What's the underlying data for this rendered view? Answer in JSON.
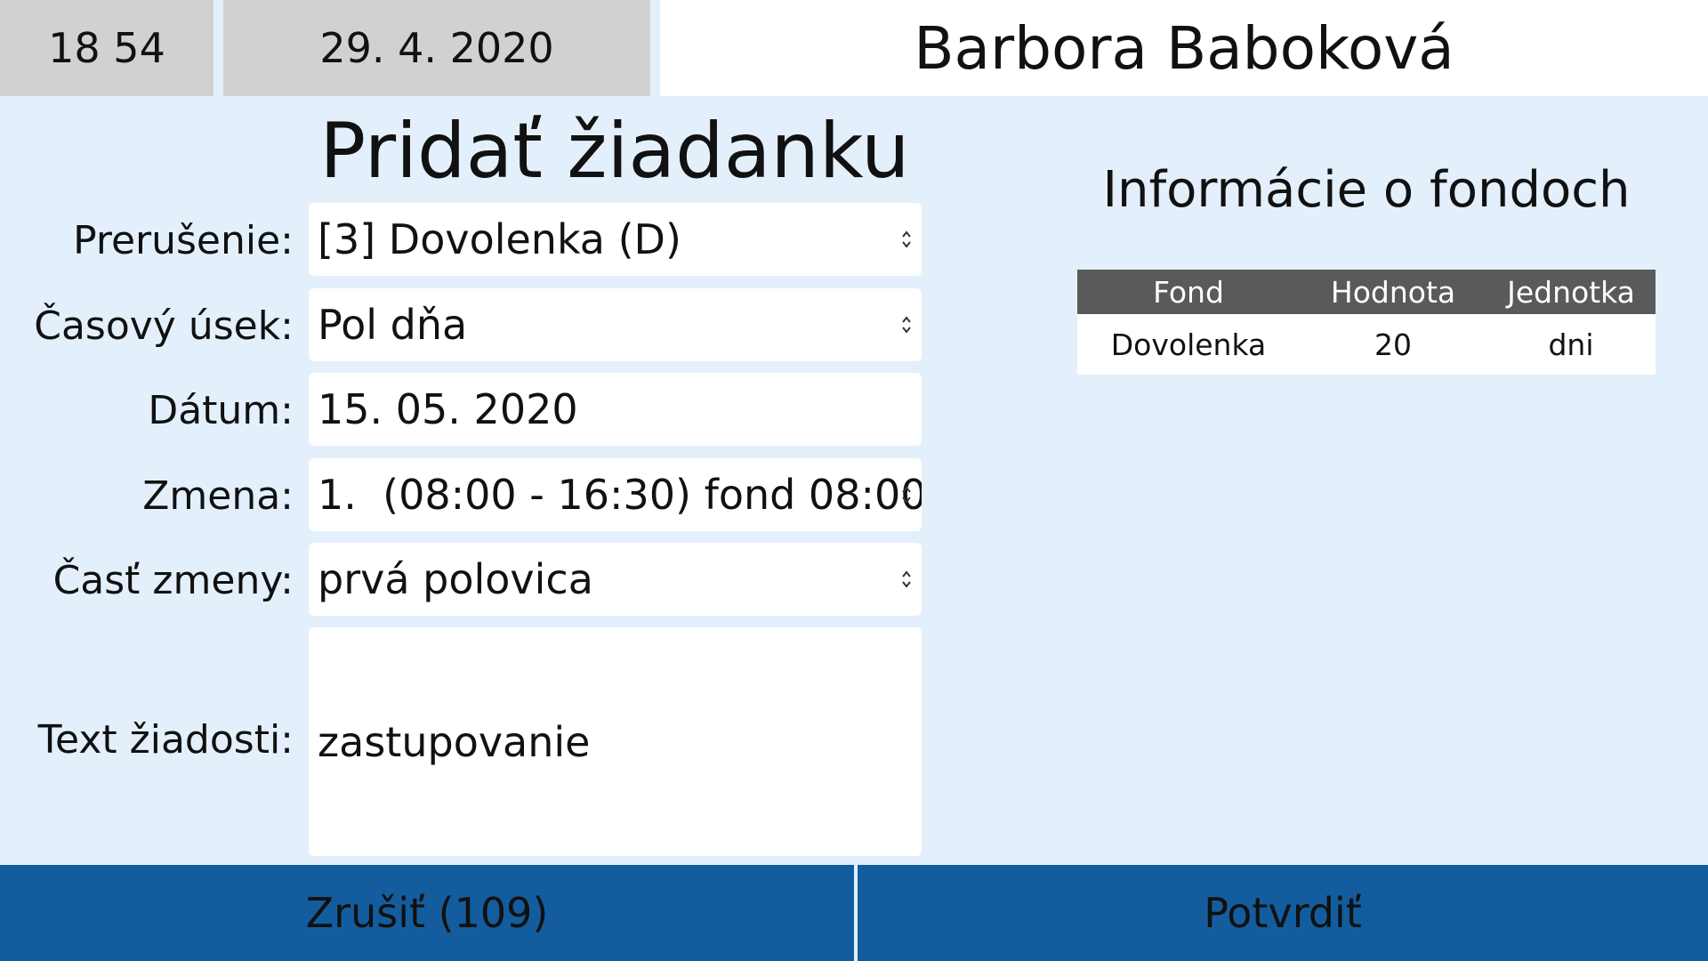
{
  "header": {
    "time": "18 54",
    "date": "29. 4. 2020",
    "user_name": "Barbora Baboková"
  },
  "page_title": "Pridať žiadanku",
  "form": {
    "interruption": {
      "label": "Prerušenie:",
      "value": "[3] Dovolenka (D)"
    },
    "time_period": {
      "label": "Časový úsek:",
      "value": "Pol dňa"
    },
    "date": {
      "label": "Dátum:",
      "value": "15. 05. 2020"
    },
    "shift": {
      "label": "Zmena:",
      "value": "1.  (08:00 - 16:30) fond 08:00"
    },
    "shift_part": {
      "label": "Časť zmeny:",
      "value": "prvá polovica"
    },
    "request_text": {
      "label": "Text žiadosti:",
      "value": "zastupovanie"
    }
  },
  "fund_info": {
    "title": "Informácie o fondoch",
    "columns": [
      "Fond",
      "Hodnota",
      "Jednotka"
    ],
    "rows": [
      [
        "Dovolenka",
        "20",
        "dni"
      ]
    ]
  },
  "footer": {
    "cancel_label": "Zrušiť (109)",
    "confirm_label": "Potvrdiť"
  },
  "colors": {
    "background": "#e3f0fc",
    "header_gray": "#d1d1d1",
    "button_blue": "#135d9e",
    "table_header": "#5a5a5a"
  }
}
